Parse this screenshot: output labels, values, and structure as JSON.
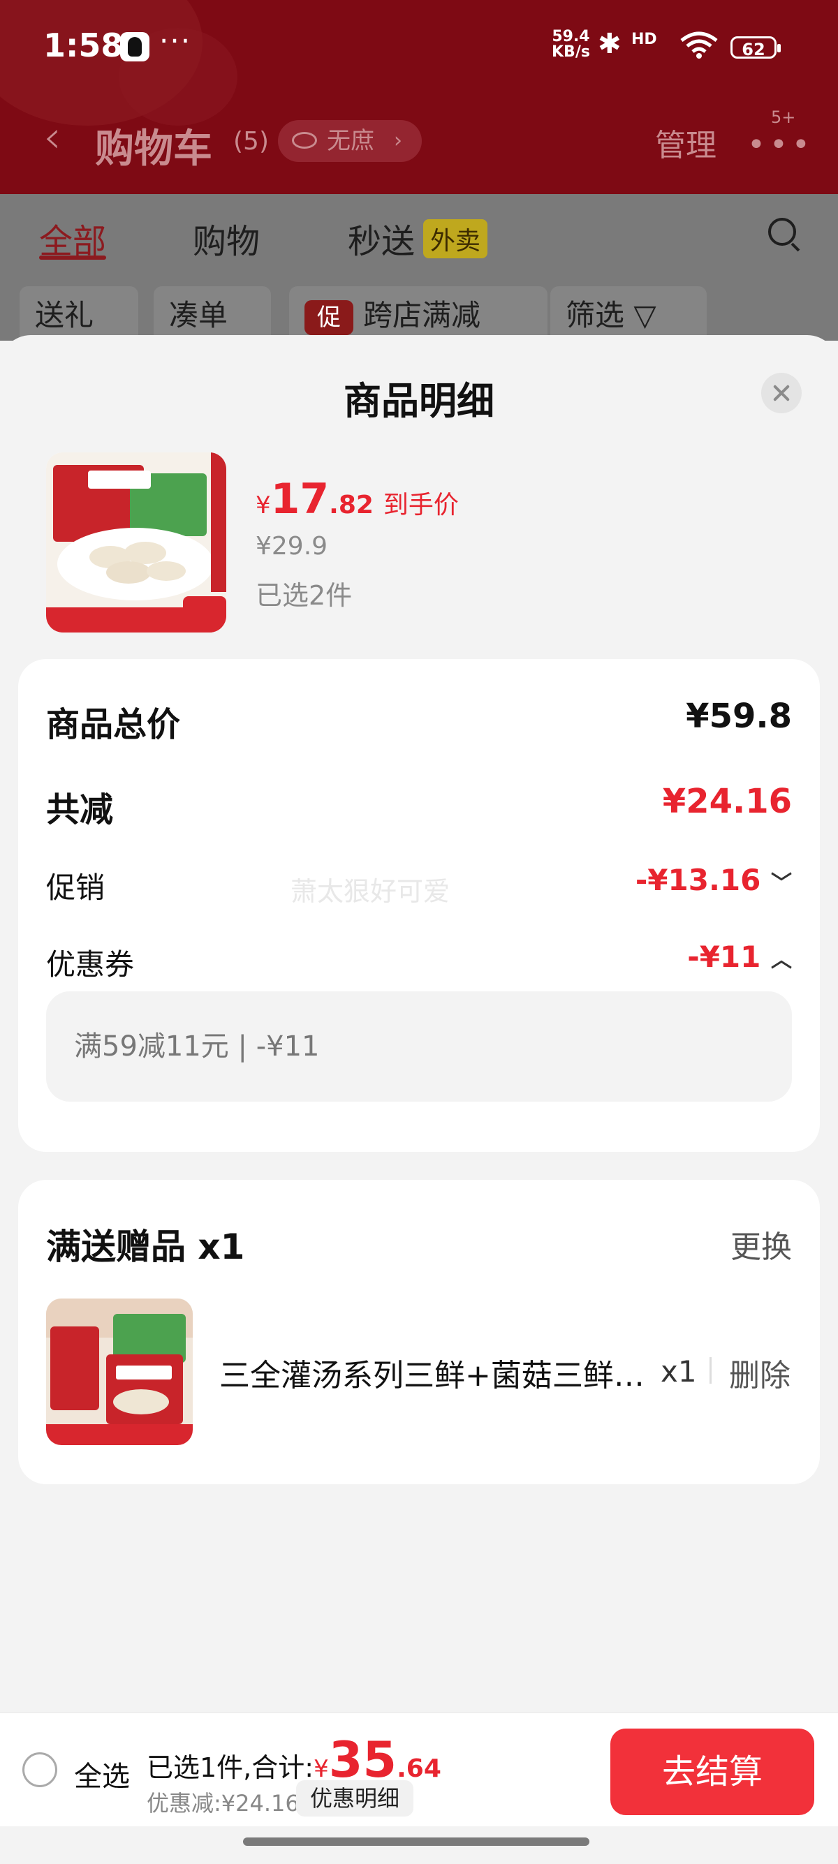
{
  "status_bar": {
    "time": "1:58",
    "net_speed": "59.4\nKB/s",
    "signal": "HD",
    "battery": "62"
  },
  "cart_header": {
    "title": "购物车",
    "count": "(5)",
    "privacy_pill": "无庶",
    "manage": "管理",
    "more_badge": "5+"
  },
  "cart_tabs": [
    "全部",
    "购物",
    "秒送",
    "外卖"
  ],
  "cart_chips": [
    "送礼",
    "凑单",
    "跨店满减",
    "筛选"
  ],
  "promo_badge": "促",
  "sheet": {
    "title": "商品明细",
    "product": {
      "price_symbol": "¥",
      "price_int": "17",
      "price_dec": ".82",
      "price_tag": "到手价",
      "original_price": "¥29.9",
      "selected": "已选2件"
    },
    "summary": {
      "total_label": "商品总价",
      "total_value": "¥59.8",
      "reduce_label": "共减",
      "reduce_value": "¥24.16",
      "promo_label": "促销",
      "promo_value": "-¥13.16",
      "coupon_label": "优惠券",
      "coupon_value": "-¥11",
      "coupon_detail": "满59减11元 | -¥11"
    },
    "watermark": "萧太狠好可爱",
    "gift": {
      "title": "满送赠品 x1",
      "change": "更换",
      "name": "三全灌汤系列三鲜+菌菇三鲜水饺",
      "qty": "x1",
      "delete": "删除"
    }
  },
  "bottom_bar": {
    "select_all": "全选",
    "summary_prefix": "已选1件,合计:",
    "total_symbol": "¥",
    "total_int": "35",
    "total_dec": ".64",
    "discount": "优惠减:¥24.16",
    "detail_button": "优惠明细",
    "checkout": "去结算"
  },
  "colors": {
    "accent_red": "#e8242f",
    "checkout_red": "#f2313a",
    "header_dark_red": "#7e0a14"
  }
}
